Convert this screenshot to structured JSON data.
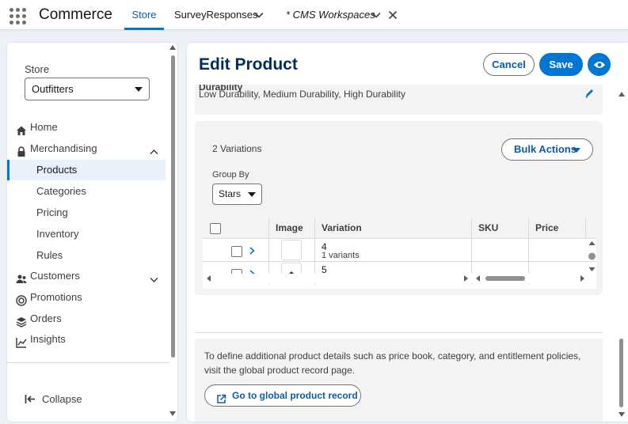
{
  "app": {
    "name": "Commerce"
  },
  "tabs": [
    {
      "label": "Store",
      "active": true
    },
    {
      "label": "SurveyResponses"
    },
    {
      "label": "* CMS Workspaces"
    }
  ],
  "sidebar": {
    "store_label": "Store",
    "store_value": "Outfitters",
    "items": [
      {
        "label": "Home",
        "icon": "home-icon"
      },
      {
        "label": "Merchandising",
        "icon": "lock-icon",
        "expanded": true
      },
      {
        "label": "Products",
        "active": true
      },
      {
        "label": "Categories"
      },
      {
        "label": "Pricing"
      },
      {
        "label": "Inventory"
      },
      {
        "label": "Rules"
      },
      {
        "label": "Customers",
        "icon": "people-icon"
      },
      {
        "label": "Promotions",
        "icon": "target-icon"
      },
      {
        "label": "Orders",
        "icon": "stack-icon"
      },
      {
        "label": "Insights",
        "icon": "chart-icon"
      }
    ],
    "collapse_label": "Collapse"
  },
  "main": {
    "title": "Edit Product",
    "cancel_label": "Cancel",
    "save_label": "Save",
    "attribute": {
      "name": "Durability",
      "values": "Low Durability, Medium Durability, High Durability"
    },
    "variations": {
      "count_label": "2 Variations",
      "bulk_actions_label": "Bulk Actions",
      "group_by_label": "Group By",
      "group_by_value": "Stars",
      "columns": [
        "Image",
        "Variation",
        "SKU",
        "Price"
      ],
      "rows": [
        {
          "variation": "4",
          "sub": "1 variants"
        },
        {
          "variation": "5",
          "sub": ""
        }
      ]
    },
    "info_text": "To define additional product details such as price book, category, and entitlement policies, visit the global product record page.",
    "go_button_label": "Go to global product record"
  },
  "colors": {
    "brand_blue": "#0176d3",
    "title_navy": "#032d60",
    "link_blue": "#0b5cab"
  }
}
